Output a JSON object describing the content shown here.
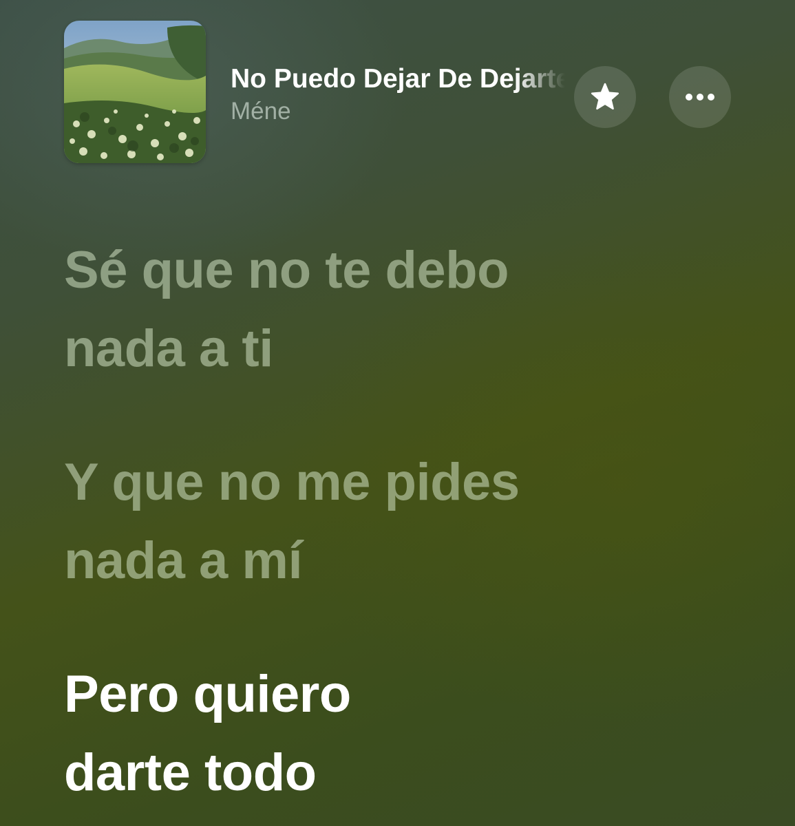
{
  "now_playing": {
    "title": "No Puedo Dejar De Dejarte",
    "artist": "Méne",
    "artwork_icon": "album-artwork-landscape",
    "favorite_icon": "star-icon",
    "more_icon": "ellipsis-icon"
  },
  "lyrics": {
    "lines": [
      {
        "text": "Sé que no te debo\nnada a ti",
        "state": "past"
      },
      {
        "text": "Y que no me pides\nnada a mí",
        "state": "past"
      },
      {
        "text": "Pero quiero\ndarte todo",
        "state": "current"
      }
    ]
  },
  "colors": {
    "background_top": "#3d5046",
    "background_bottom": "#3b4d1d",
    "lyric_dim": "#cddebe",
    "lyric_active": "#ffffff"
  }
}
